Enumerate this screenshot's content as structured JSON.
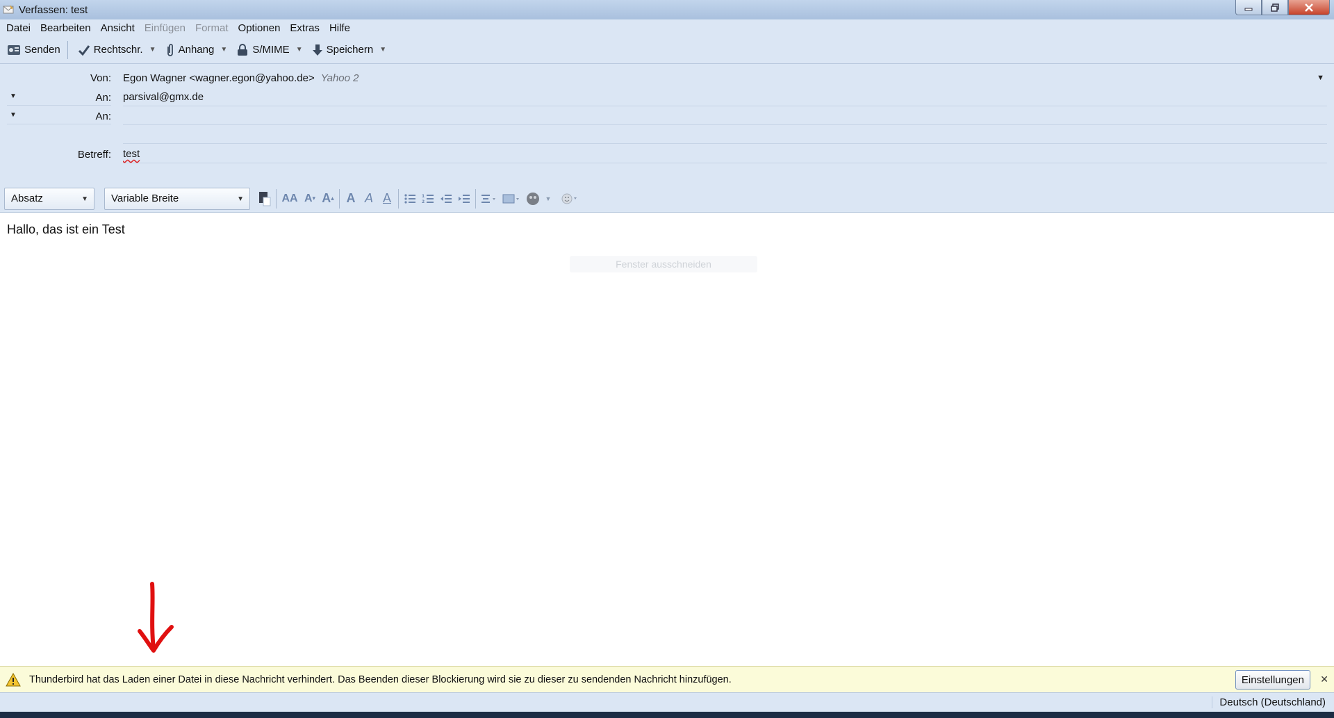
{
  "window": {
    "title": "Verfassen: test"
  },
  "menu": {
    "items": [
      {
        "label": "Datei",
        "disabled": false
      },
      {
        "label": "Bearbeiten",
        "disabled": false
      },
      {
        "label": "Ansicht",
        "disabled": false
      },
      {
        "label": "Einfügen",
        "disabled": true
      },
      {
        "label": "Format",
        "disabled": true
      },
      {
        "label": "Optionen",
        "disabled": false
      },
      {
        "label": "Extras",
        "disabled": false
      },
      {
        "label": "Hilfe",
        "disabled": false
      }
    ]
  },
  "toolbar": {
    "send_label": "Senden",
    "spell_label": "Rechtschr.",
    "attach_label": "Anhang",
    "smime_label": "S/MIME",
    "save_label": "Speichern"
  },
  "headers": {
    "from_label": "Von:",
    "from_value": "Egon Wagner <wagner.egon@yahoo.de>",
    "from_account": "Yahoo 2",
    "to_label": "An:",
    "to_value": "parsival@gmx.de",
    "to2_label": "An:",
    "to2_value": "",
    "subject_label": "Betreff:",
    "subject_value": "test"
  },
  "format_bar": {
    "paragraph_style": "Absatz",
    "font": "Variable Breite"
  },
  "body": {
    "text": "Hallo, das ist ein Test",
    "ghost_tooltip": "Fenster ausschneiden"
  },
  "notification": {
    "text": "Thunderbird hat das Laden einer Datei in diese Nachricht verhindert. Das Beenden dieser Blockierung wird sie zu dieser zu sendenden Nachricht hinzufügen.",
    "button_label": "Einstellungen"
  },
  "status": {
    "language": "Deutsch (Deutschland)"
  },
  "colors": {
    "chrome": "#dbe6f4",
    "notification_bg": "#fbfbd9",
    "annotation_arrow": "#e01010"
  }
}
